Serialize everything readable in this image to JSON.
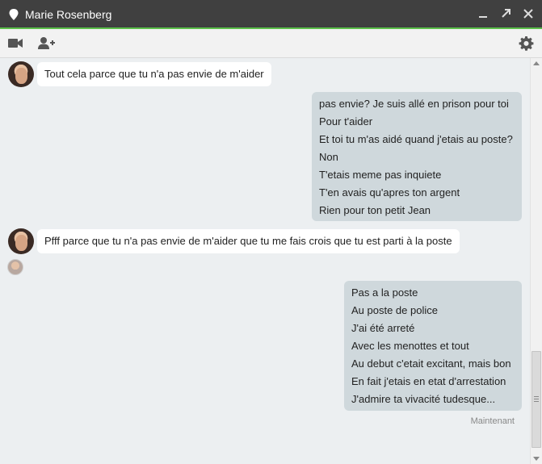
{
  "window": {
    "title": "Marie Rosenberg",
    "title_icon": "location-pin-icon",
    "controls": [
      "minimize-icon",
      "popout-icon",
      "close-icon"
    ],
    "accent_color": "#5bbf49"
  },
  "toolbar": {
    "left_icons": [
      "video-call-icon",
      "add-person-icon"
    ],
    "right_icon": "settings-gear-icon"
  },
  "messages": {
    "incoming_1": "Tout cela parce que tu n'a pas envie de m'aider",
    "outgoing_1": [
      "pas envie? Je suis allé en prison pour toi",
      "Pour t'aider",
      "Et toi tu m'as aidé quand j'etais au poste?",
      "Non",
      "T'etais meme pas inquiete",
      "T'en avais qu'apres ton argent",
      "Rien pour ton petit Jean"
    ],
    "incoming_2": "Pfff parce que tu n'a pas envie de m'aider que tu me fais crois que tu est parti à la poste",
    "outgoing_2": [
      "Pas a la poste",
      "Au poste de police",
      "J'ai été arreté",
      "Avec les menottes et tout",
      "Au debut c'etait excitant, mais bon",
      "En fait j'etais en etat d'arrestation",
      "J'admire ta vivacité tudesque..."
    ],
    "timestamp": "Maintenant"
  }
}
